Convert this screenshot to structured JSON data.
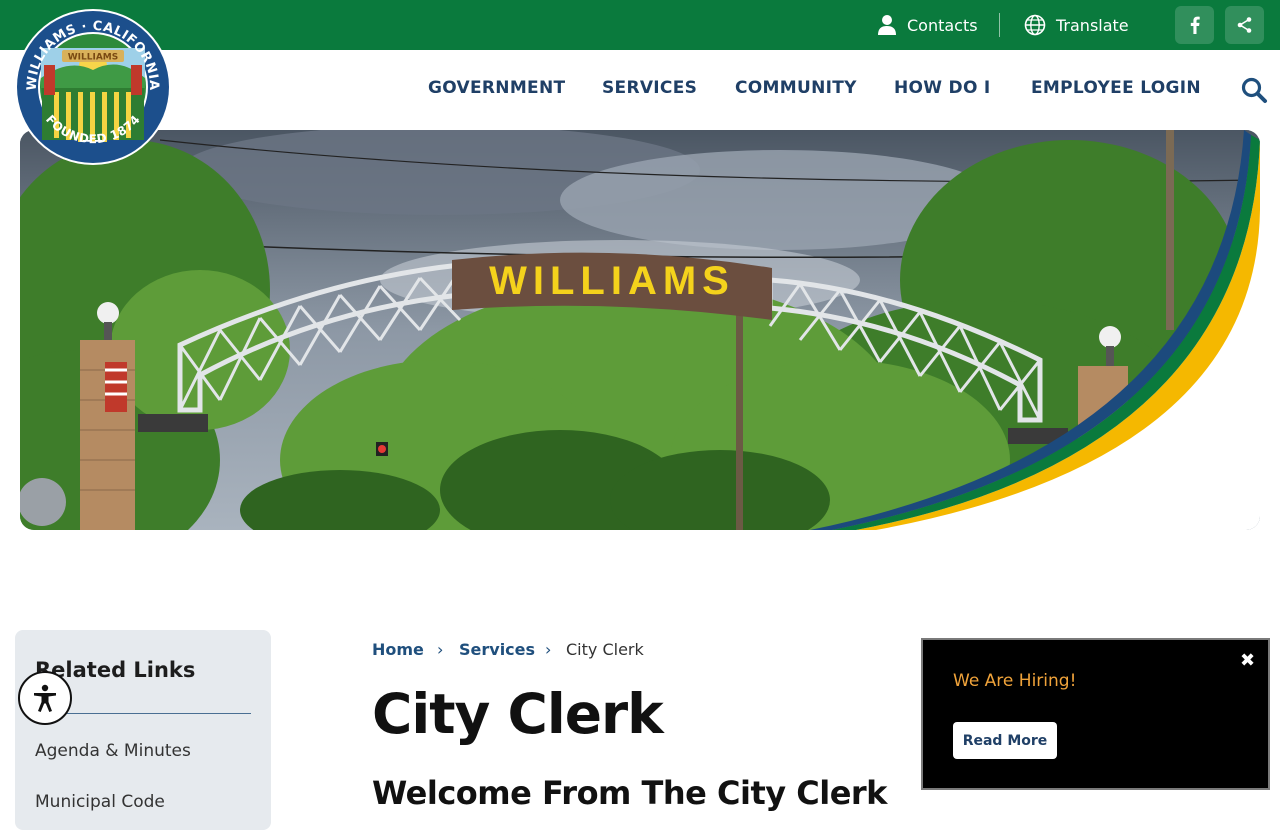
{
  "utility": {
    "contacts": "Contacts",
    "translate": "Translate"
  },
  "seal": {
    "top_text": "WILLIAMS · CALIFORNIA",
    "bottom_text": "FOUNDED 1874",
    "banner": "WILLIAMS"
  },
  "nav": {
    "items": [
      "GOVERNMENT",
      "SERVICES",
      "COMMUNITY",
      "HOW DO I",
      "EMPLOYEE LOGIN"
    ]
  },
  "hero": {
    "sign_text": "WILLIAMS"
  },
  "sidebar": {
    "title": "Related Links",
    "links": [
      "Agenda & Minutes",
      "Municipal Code"
    ]
  },
  "breadcrumb": {
    "home": "Home",
    "services": "Services",
    "current": "City Clerk",
    "separator": "›"
  },
  "page": {
    "title": "City Clerk",
    "subtitle": "Welcome From The City Clerk"
  },
  "popup": {
    "close": "✖",
    "text": "We Are Hiring!",
    "button": "Read More"
  },
  "colors": {
    "brand_green": "#0a7a3d",
    "nav_blue": "#1f3f66",
    "accent_gold": "#f5b800",
    "accent_blue": "#1c4a7d"
  }
}
